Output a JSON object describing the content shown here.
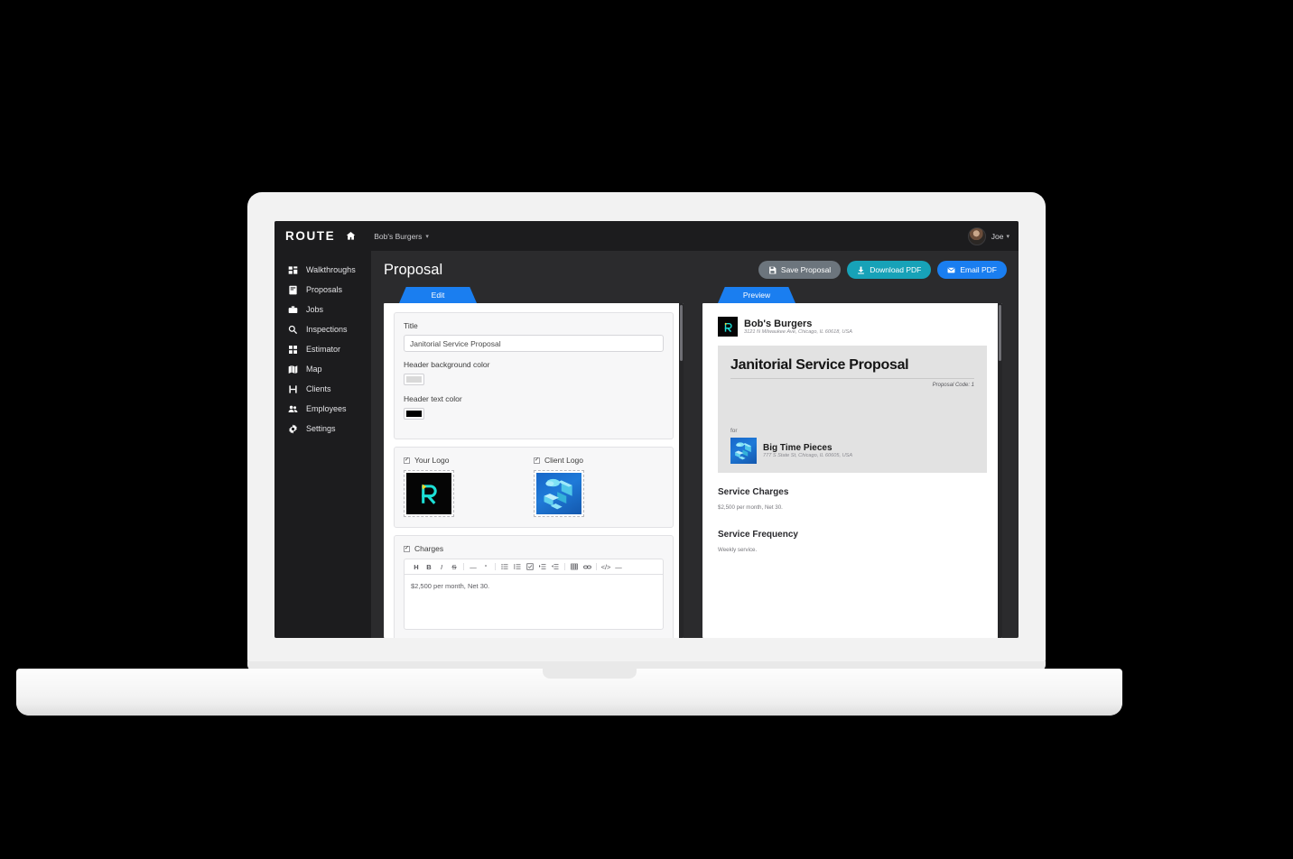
{
  "topbar": {
    "brand": "ROUTE",
    "home_icon": "home-icon",
    "breadcrumb": "Bob's Burgers",
    "breadcrumb_caret": "▾",
    "user_name": "Joe",
    "user_caret": "▾"
  },
  "sidebar": {
    "items": [
      {
        "label": "Walkthroughs",
        "icon": "walkthroughs-icon"
      },
      {
        "label": "Proposals",
        "icon": "proposals-icon"
      },
      {
        "label": "Jobs",
        "icon": "jobs-icon"
      },
      {
        "label": "Inspections",
        "icon": "inspections-icon"
      },
      {
        "label": "Estimator",
        "icon": "estimator-icon"
      },
      {
        "label": "Map",
        "icon": "map-icon"
      },
      {
        "label": "Clients",
        "icon": "clients-icon"
      },
      {
        "label": "Employees",
        "icon": "employees-icon"
      },
      {
        "label": "Settings",
        "icon": "settings-icon"
      }
    ]
  },
  "main": {
    "page_title": "Proposal",
    "buttons": {
      "save": {
        "label": "Save Proposal",
        "icon": "save-icon",
        "color": "#6c757d"
      },
      "download": {
        "label": "Download PDF",
        "icon": "download-icon",
        "color": "#17a2b8"
      },
      "email": {
        "label": "Email PDF",
        "icon": "envelope-icon",
        "color": "#1a7ef0"
      }
    }
  },
  "edit_pane": {
    "tab_label": "Edit",
    "title_label": "Title",
    "title_value": "Janitorial Service Proposal",
    "header_bg_label": "Header background color",
    "header_bg_color": "#d9d9d9",
    "header_text_label": "Header text color",
    "header_text_color": "#000000",
    "your_logo_label": "Your Logo",
    "your_logo_checked": true,
    "client_logo_label": "Client Logo",
    "client_logo_checked": true,
    "charges_label": "Charges",
    "charges_checked": true,
    "charges_text": "$2,500 per month, Net 30.",
    "toolbar_icons": [
      "heading-icon",
      "bold-icon",
      "italic-icon",
      "strikethrough-icon",
      "sep",
      "horizontal-rule-icon",
      "blockquote-icon",
      "sep",
      "bullet-list-icon",
      "numbered-list-icon",
      "checklist-icon",
      "indent-increase-icon",
      "indent-decrease-icon",
      "sep",
      "table-icon",
      "link-icon",
      "sep",
      "code-icon",
      "more-icon"
    ]
  },
  "preview_pane": {
    "tab_label": "Preview",
    "company_name": "Bob's Burgers",
    "company_address": "3121 N Milwaukee Ave, Chicago, IL 60618, USA",
    "company_logo": "route-r-logo",
    "banner_title": "Janitorial Service Proposal",
    "proposal_code": "Proposal Code: 1",
    "for_label": "for",
    "client_name": "Big Time Pieces",
    "client_address": "777 S State St, Chicago, IL 60605, USA",
    "client_logo": "isometric-tech-logo",
    "sections": [
      {
        "heading": "Service Charges",
        "body": "$2,500 per month, Net 30."
      },
      {
        "heading": "Service Frequency",
        "body": "Weekly service."
      }
    ]
  }
}
